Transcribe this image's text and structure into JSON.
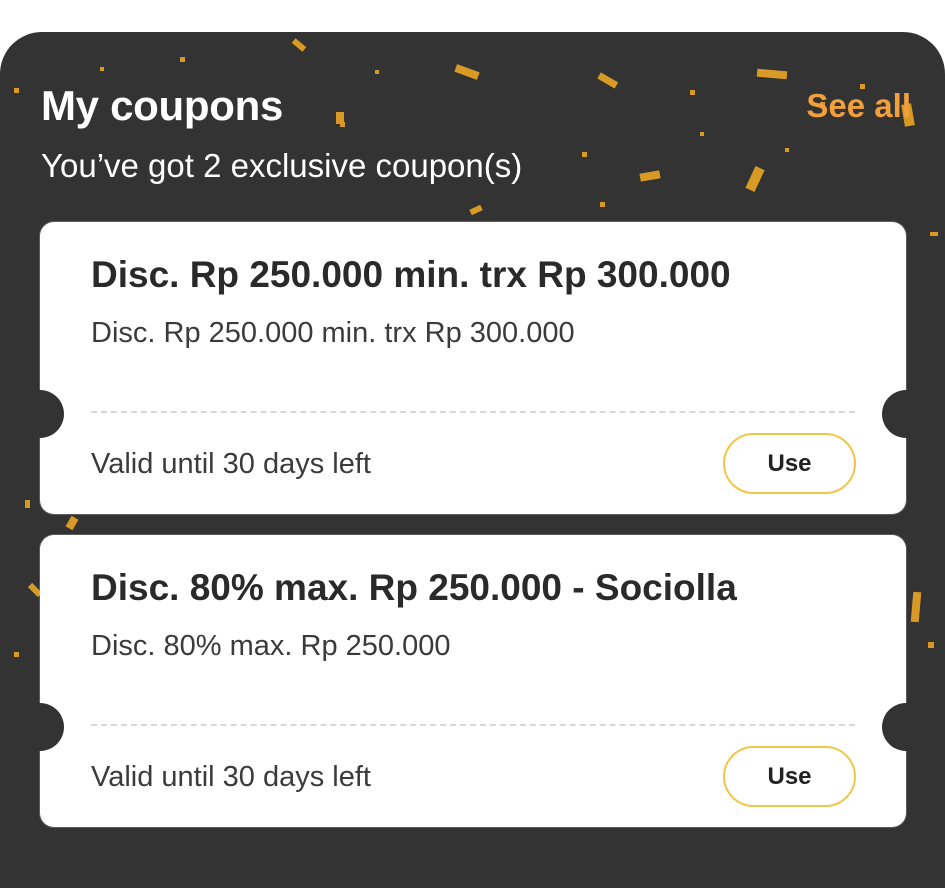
{
  "header": {
    "title": "My coupons",
    "see_all_label": "See all",
    "subtitle": "You’ve got 2 exclusive coupon(s)"
  },
  "coupons": [
    {
      "title": "Disc. Rp 250.000 min. trx Rp 300.000",
      "description": "Disc. Rp 250.000 min. trx Rp 300.000",
      "validity": "Valid until 30 days left",
      "button_label": "Use"
    },
    {
      "title": "Disc. 80% max. Rp 250.000 - Sociolla",
      "description": "Disc. 80% max. Rp 250.000",
      "validity": "Valid until 30 days left",
      "button_label": "Use"
    }
  ],
  "colors": {
    "panel_background": "#333333",
    "accent": "#f2a03d",
    "button_border": "#f0c64a",
    "confetti": "#e0a42a"
  }
}
